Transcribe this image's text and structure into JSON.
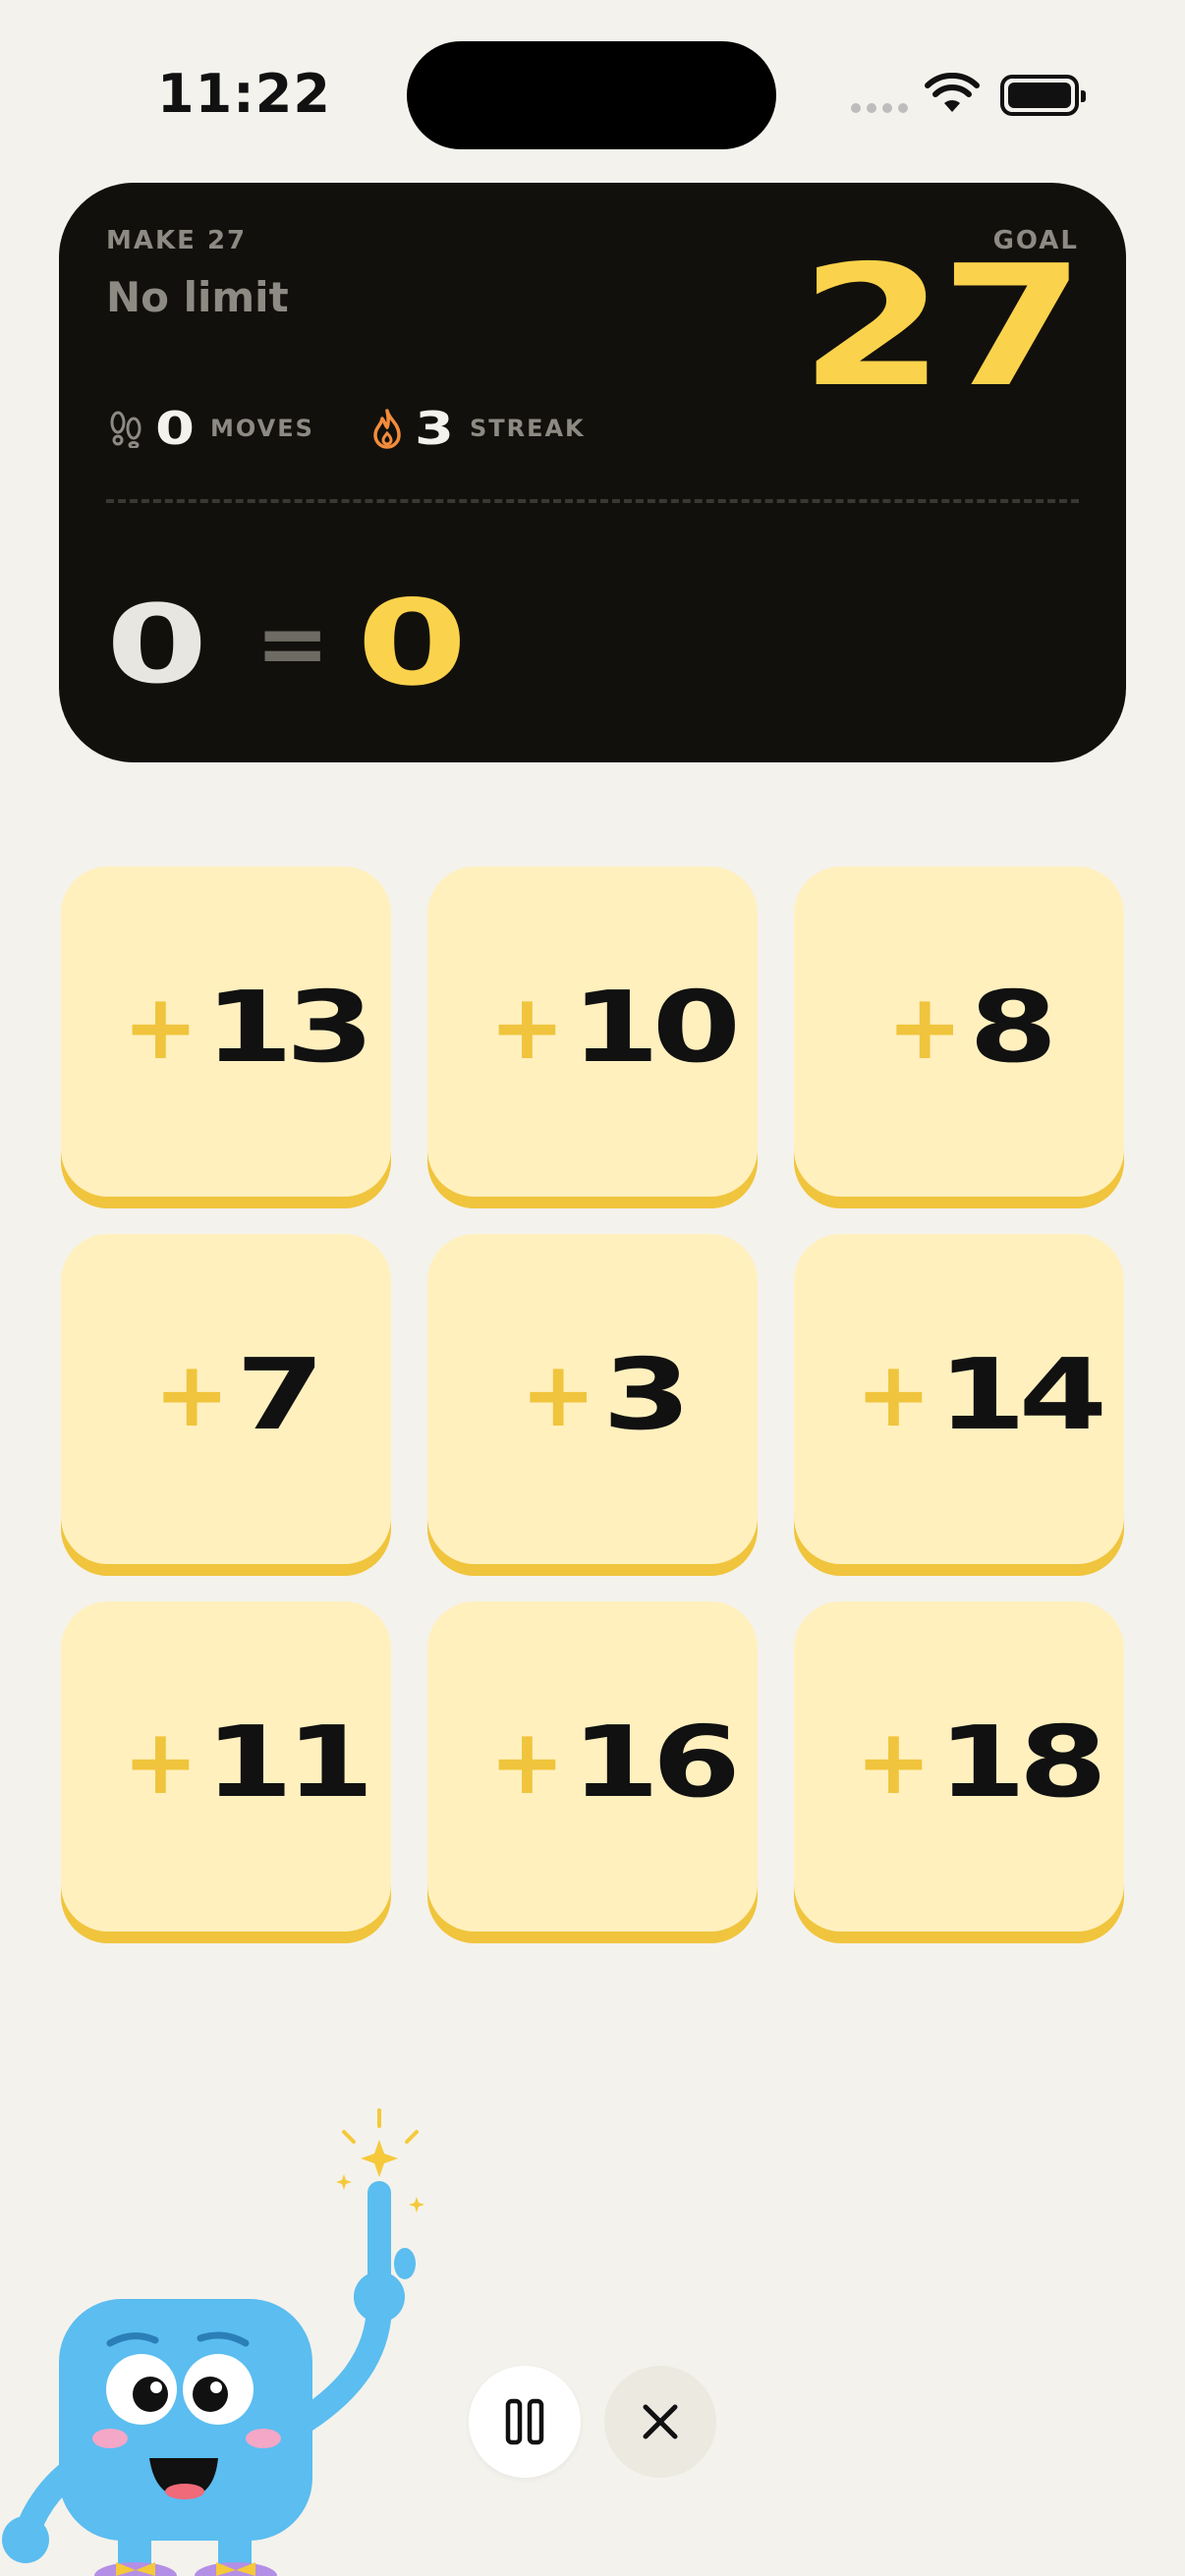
{
  "status_bar": {
    "time": "11:22"
  },
  "header": {
    "mode_label": "MAKE 27",
    "mode_sub": "No limit",
    "goal_label": "GOAL",
    "goal_value": "27",
    "moves_value": "0",
    "moves_label": "MOVES",
    "streak_value": "3",
    "streak_label": "STREAK",
    "equation_left": "0",
    "equation_sign": "=",
    "equation_result": "0"
  },
  "tiles": [
    {
      "plus": "+",
      "value": "13"
    },
    {
      "plus": "+",
      "value": "10"
    },
    {
      "plus": "+",
      "value": "8"
    },
    {
      "plus": "+",
      "value": "7"
    },
    {
      "plus": "+",
      "value": "3"
    },
    {
      "plus": "+",
      "value": "14"
    },
    {
      "plus": "+",
      "value": "11"
    },
    {
      "plus": "+",
      "value": "16"
    },
    {
      "plus": "+",
      "value": "18"
    }
  ],
  "colors": {
    "background": "#F4F2EC",
    "card": "#12100C",
    "accent_yellow": "#FAD24B",
    "tile_fill": "#FFF0BE",
    "tile_shadow": "#F0C43C",
    "mascot_blue": "#5BBDF0",
    "streak_flame": "#F28C3C"
  },
  "icons": {
    "moves": "footprints-icon",
    "streak": "flame-icon",
    "pause": "pause-icon",
    "close": "close-icon"
  }
}
